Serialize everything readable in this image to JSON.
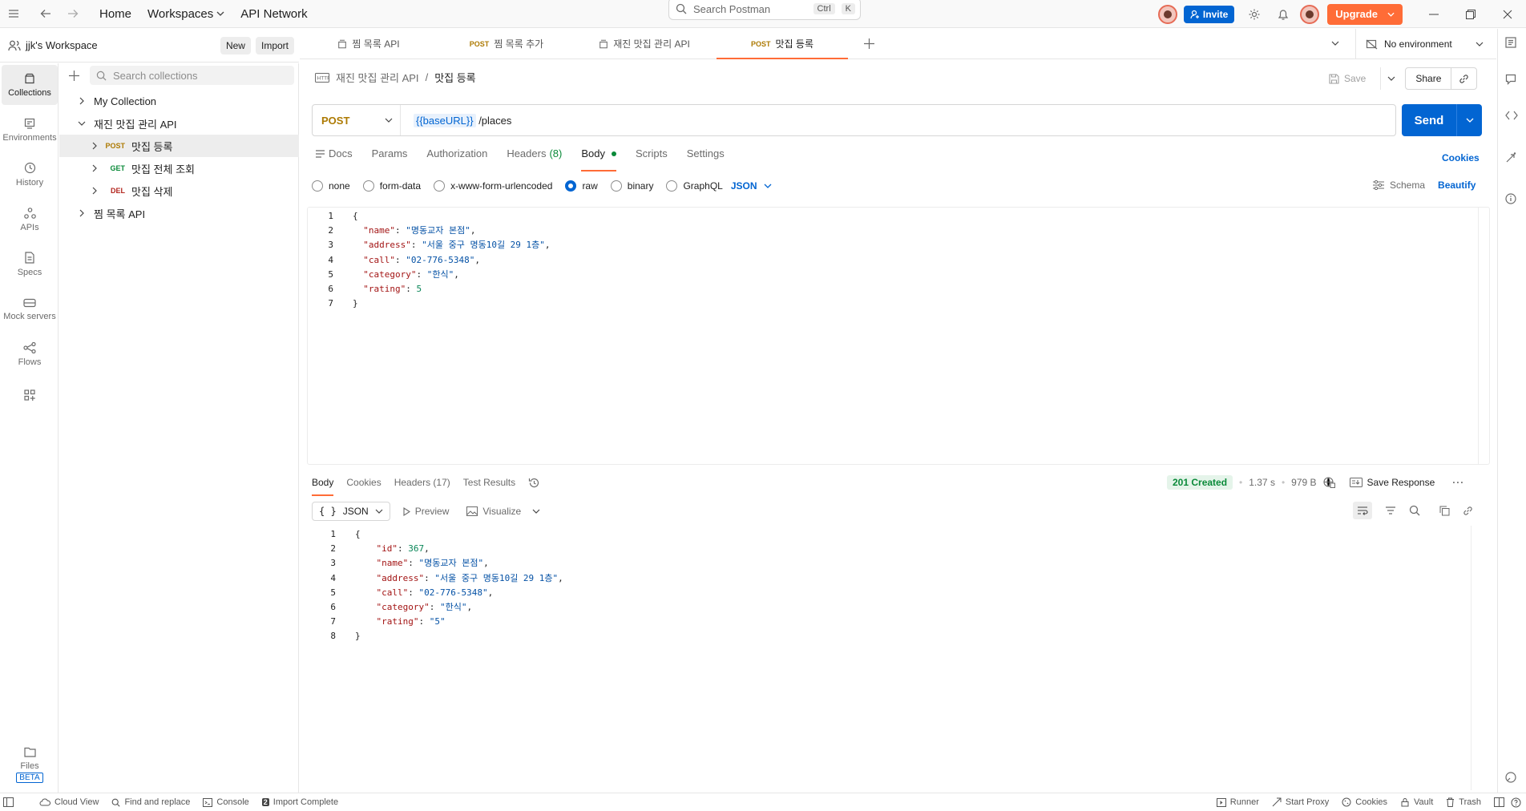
{
  "topbar": {
    "home": "Home",
    "workspaces": "Workspaces",
    "api_network": "API Network",
    "search_placeholder": "Search Postman",
    "shortcut_ctrl": "Ctrl",
    "shortcut_k": "K",
    "invite": "Invite",
    "upgrade": "Upgrade"
  },
  "workspace": {
    "name": "jjk's Workspace",
    "new_label": "New",
    "import_label": "Import"
  },
  "leftnav": [
    {
      "label": "Collections",
      "icon": "collections-icon"
    },
    {
      "label": "Environments",
      "icon": "environments-icon"
    },
    {
      "label": "History",
      "icon": "history-icon"
    },
    {
      "label": "APIs",
      "icon": "apis-icon"
    },
    {
      "label": "Specs",
      "icon": "specs-icon"
    },
    {
      "label": "Mock servers",
      "icon": "mock-servers-icon"
    },
    {
      "label": "Flows",
      "icon": "flows-icon"
    }
  ],
  "files": {
    "label": "Files",
    "badge": "BETA"
  },
  "sidebar": {
    "search_placeholder": "Search collections",
    "tree": [
      {
        "label": "My Collection"
      },
      {
        "label": "재진 맛집 관리 API"
      },
      {
        "method": "POST",
        "label": "맛집 등록"
      },
      {
        "method": "GET",
        "label": "맛집 전체 조회"
      },
      {
        "method": "DEL",
        "label": "맛집 삭제"
      },
      {
        "label": "찜 목록 API"
      }
    ]
  },
  "tabs": [
    {
      "method": "",
      "label": "찜 목록 API"
    },
    {
      "method": "POST",
      "label": "찜 목록 추가"
    },
    {
      "method": "",
      "label": "재진 맛집 관리 API"
    },
    {
      "method": "POST",
      "label": "맛집 등록"
    }
  ],
  "environment": "No environment",
  "breadcrumb": {
    "parent": "재진 맛집 관리 API",
    "sep": "/",
    "current": "맛집 등록"
  },
  "save_label": "Save",
  "share_label": "Share",
  "request": {
    "method": "POST",
    "url_var": "{{baseURL}}",
    "url_path": " /places",
    "send": "Send"
  },
  "req_tabs": {
    "docs": "Docs",
    "params": "Params",
    "authorization": "Authorization",
    "headers": "Headers",
    "headers_count": "(8)",
    "body": "Body",
    "scripts": "Scripts",
    "settings": "Settings",
    "cookies": "Cookies"
  },
  "body_options": {
    "none": "none",
    "form_data": "form-data",
    "urlencoded": "x-www-form-urlencoded",
    "raw": "raw",
    "binary": "binary",
    "graphql": "GraphQL",
    "json": "JSON",
    "schema": "Schema",
    "beautify": "Beautify"
  },
  "request_body": [
    {
      "n": "1",
      "parts": [
        [
          "p",
          "{"
        ]
      ]
    },
    {
      "n": "2",
      "parts": [
        [
          "p",
          "  "
        ],
        [
          "k",
          "\"name\""
        ],
        [
          "p",
          ": "
        ],
        [
          "s",
          "\"명동교자 본점\""
        ],
        [
          "p",
          ","
        ]
      ]
    },
    {
      "n": "3",
      "parts": [
        [
          "p",
          "  "
        ],
        [
          "k",
          "\"address\""
        ],
        [
          "p",
          ": "
        ],
        [
          "s",
          "\"서울 중구 명동10길 29 1층\""
        ],
        [
          "p",
          ","
        ]
      ]
    },
    {
      "n": "4",
      "parts": [
        [
          "p",
          "  "
        ],
        [
          "k",
          "\"call\""
        ],
        [
          "p",
          ": "
        ],
        [
          "s",
          "\"02-776-5348\""
        ],
        [
          "p",
          ","
        ]
      ]
    },
    {
      "n": "5",
      "parts": [
        [
          "p",
          "  "
        ],
        [
          "k",
          "\"category\""
        ],
        [
          "p",
          ": "
        ],
        [
          "s",
          "\"한식\""
        ],
        [
          "p",
          ","
        ]
      ]
    },
    {
      "n": "6",
      "parts": [
        [
          "p",
          "  "
        ],
        [
          "k",
          "\"rating\""
        ],
        [
          "p",
          ": "
        ],
        [
          "n",
          "5"
        ]
      ]
    },
    {
      "n": "7",
      "parts": [
        [
          "p",
          "}"
        ]
      ]
    }
  ],
  "response": {
    "tabs": {
      "body": "Body",
      "cookies": "Cookies",
      "headers": "Headers",
      "headers_count": "(17)",
      "test_results": "Test Results"
    },
    "status": "201 Created",
    "time": "1.37 s",
    "size": "979 B",
    "save_response": "Save Response",
    "format": "JSON",
    "preview": "Preview",
    "visualize": "Visualize"
  },
  "response_body": [
    {
      "n": "1",
      "parts": [
        [
          "p",
          "{"
        ]
      ]
    },
    {
      "n": "2",
      "parts": [
        [
          "p",
          "    "
        ],
        [
          "k",
          "\"id\""
        ],
        [
          "p",
          ": "
        ],
        [
          "n",
          "367"
        ],
        [
          "p",
          ","
        ]
      ]
    },
    {
      "n": "3",
      "parts": [
        [
          "p",
          "    "
        ],
        [
          "k",
          "\"name\""
        ],
        [
          "p",
          ": "
        ],
        [
          "s",
          "\"명동교자 본점\""
        ],
        [
          "p",
          ","
        ]
      ]
    },
    {
      "n": "4",
      "parts": [
        [
          "p",
          "    "
        ],
        [
          "k",
          "\"address\""
        ],
        [
          "p",
          ": "
        ],
        [
          "s",
          "\"서울 중구 명동10길 29 1층\""
        ],
        [
          "p",
          ","
        ]
      ]
    },
    {
      "n": "5",
      "parts": [
        [
          "p",
          "    "
        ],
        [
          "k",
          "\"call\""
        ],
        [
          "p",
          ": "
        ],
        [
          "s",
          "\"02-776-5348\""
        ],
        [
          "p",
          ","
        ]
      ]
    },
    {
      "n": "6",
      "parts": [
        [
          "p",
          "    "
        ],
        [
          "k",
          "\"category\""
        ],
        [
          "p",
          ": "
        ],
        [
          "s",
          "\"한식\""
        ],
        [
          "p",
          ","
        ]
      ]
    },
    {
      "n": "7",
      "parts": [
        [
          "p",
          "    "
        ],
        [
          "k",
          "\"rating\""
        ],
        [
          "p",
          ": "
        ],
        [
          "s",
          "\"5\""
        ]
      ]
    },
    {
      "n": "8",
      "parts": [
        [
          "p",
          "}"
        ]
      ]
    }
  ],
  "statusbar": {
    "cloud_view": "Cloud View",
    "find_replace": "Find and replace",
    "console": "Console",
    "import_complete": "Import Complete",
    "runner": "Runner",
    "start_proxy": "Start Proxy",
    "cookies": "Cookies",
    "vault": "Vault",
    "trash": "Trash"
  },
  "colors": {
    "brand": "#ff6c37",
    "primary": "#0265d2",
    "post": "#ad7a03",
    "get": "#0a8a39",
    "del": "#b3261e"
  }
}
